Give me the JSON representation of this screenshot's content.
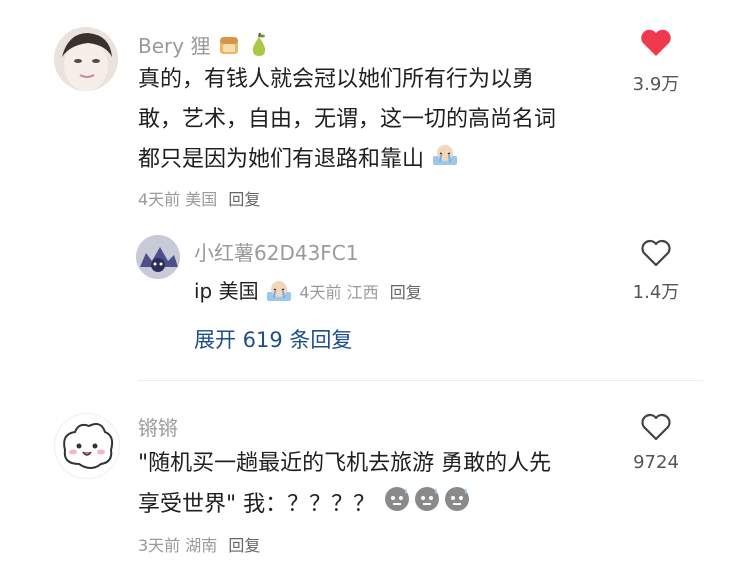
{
  "comments": [
    {
      "username": "Bery 狸",
      "username_emoji": [
        "bread-icon",
        "pear-icon"
      ],
      "text_lines": [
        "真的，有钱人就会冠以她们所有行为以勇",
        "敢，艺术，自由，无谓，这一切的高尚名词",
        "都只是因为她们有退路和靠山"
      ],
      "time": "4天前",
      "location": "美国",
      "reply_label": "回复",
      "likes": "3.9万",
      "liked": true
    },
    {
      "username": "锵锵",
      "text_lines": [
        "\"随机买一趟最近的飞机去旅游 勇敢的人先",
        "享受世界\" 我：？？？？"
      ],
      "time": "3天前",
      "location": "湖南",
      "reply_label": "回复",
      "likes": "9724",
      "liked": false
    }
  ],
  "reply": {
    "username": "小红薯62D43FC1",
    "text": "ip 美国",
    "time": "4天前",
    "location": "江西",
    "reply_label": "回复",
    "likes": "1.4万",
    "liked": false
  },
  "expand_label": "展开 619 条回复",
  "colors": {
    "like_red": "#f0384f",
    "link_blue": "#1f4e8a",
    "muted": "#9a9a9a"
  }
}
